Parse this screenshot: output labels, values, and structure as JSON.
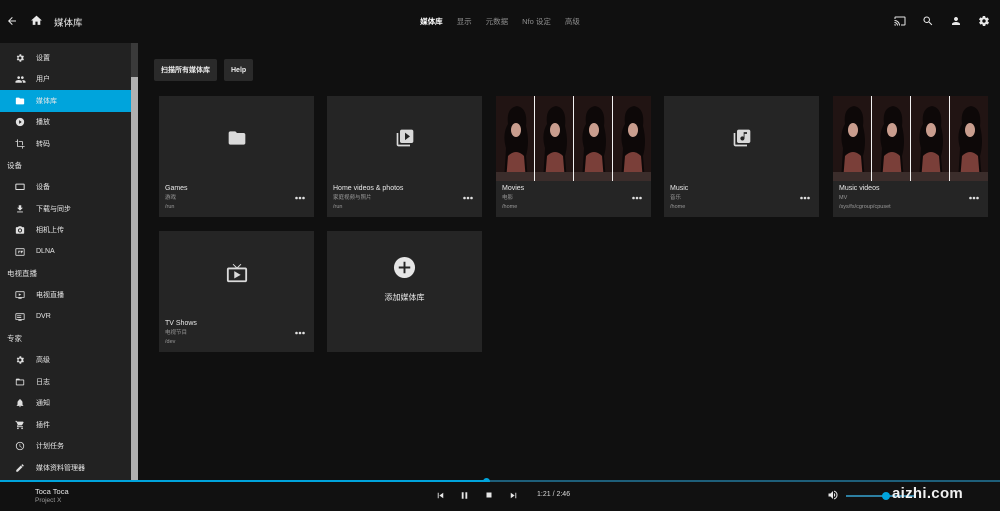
{
  "header": {
    "title": "媒体库",
    "tabs": [
      {
        "label": "媒体库",
        "active": true
      },
      {
        "label": "显示",
        "active": false
      },
      {
        "label": "元数据",
        "active": false
      },
      {
        "label": "Nfo 设定",
        "active": false
      },
      {
        "label": "高级",
        "active": false
      }
    ]
  },
  "sidebar": {
    "items_top": [
      {
        "label": "设置",
        "icon": "gear-icon"
      },
      {
        "label": "用户",
        "icon": "users-icon"
      },
      {
        "label": "媒体库",
        "icon": "folder-icon",
        "active": true
      },
      {
        "label": "播放",
        "icon": "play-circle-icon"
      },
      {
        "label": "转码",
        "icon": "crop-icon"
      }
    ],
    "section_devices": "设备",
    "items_devices": [
      {
        "label": "设备",
        "icon": "devices-icon"
      },
      {
        "label": "下载与同步",
        "icon": "download-icon"
      },
      {
        "label": "相机上传",
        "icon": "camera-icon"
      },
      {
        "label": "DLNA",
        "icon": "settings-input-icon"
      }
    ],
    "section_livetv": "电视直播",
    "items_livetv": [
      {
        "label": "电视直播",
        "icon": "live-tv-icon"
      },
      {
        "label": "DVR",
        "icon": "dvr-icon"
      }
    ],
    "section_expert": "专家",
    "items_expert": [
      {
        "label": "高级",
        "icon": "gear-icon"
      },
      {
        "label": "日志",
        "icon": "folder-open-icon"
      },
      {
        "label": "通知",
        "icon": "bell-icon"
      },
      {
        "label": "插件",
        "icon": "cart-icon"
      },
      {
        "label": "计划任务",
        "icon": "clock-icon"
      },
      {
        "label": "媒体资料管理器",
        "icon": "pencil-icon"
      }
    ]
  },
  "toolbar": {
    "scan_label": "扫描所有媒体库",
    "help_label": "Help"
  },
  "libraries": [
    {
      "name": "Games",
      "type": "游戏",
      "path": "/run",
      "icon": "folder-icon"
    },
    {
      "name": "Home videos & photos",
      "type": "家庭视频与照片",
      "path": "/run",
      "icon": "video-library-icon"
    },
    {
      "name": "Movies",
      "type": "电影",
      "path": "/home",
      "icon": "poster-image"
    },
    {
      "name": "Music",
      "type": "音乐",
      "path": "/home",
      "icon": "music-library-icon"
    },
    {
      "name": "Music videos",
      "type": "MV",
      "path": "/sys/fs/cgroup/cpuset",
      "icon": "poster-image"
    },
    {
      "name": "TV Shows",
      "type": "电视节目",
      "path": "/dev",
      "icon": "live-tv-icon"
    }
  ],
  "add_library_label": "添加媒体库",
  "player": {
    "title": "Toca Toca",
    "artist": "Project X",
    "time": "1:21 / 2:46",
    "progress": 0.486,
    "volume": 0.57
  },
  "watermark": "aizhi.com",
  "colors": {
    "accent": "#00a4dc",
    "background": "#101010",
    "sidebar": "#222222",
    "card": "#252525"
  }
}
